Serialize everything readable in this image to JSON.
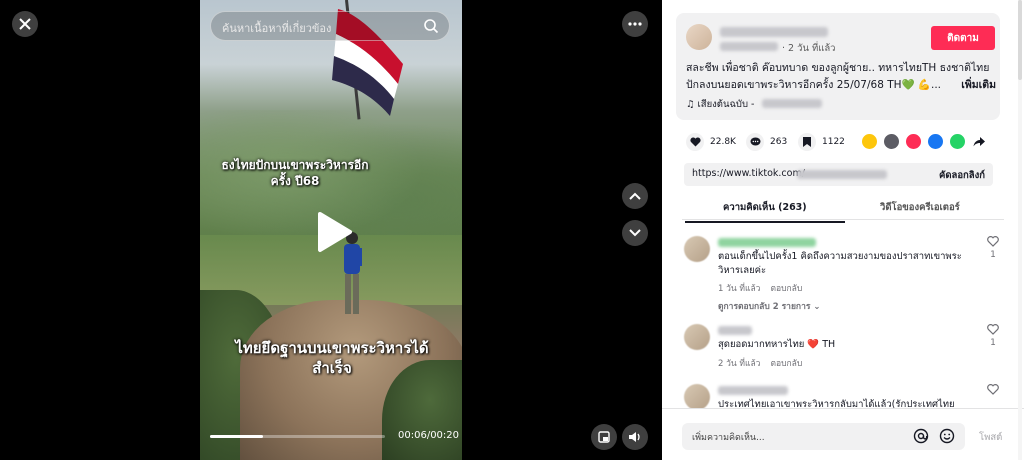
{
  "video": {
    "search_placeholder": "ค้นหาเนื้อหาที่เกี่ยวข้อง",
    "overlay_top": "ธงไทยปักบนเขาพระวิหารอีกครั้ง ปี68",
    "overlay_bottom": "ไทยยึดฐานบนเขาพระวิหารได้สำเร็จ",
    "time": "00:06/00:20",
    "progress_fraction": 0.3
  },
  "post": {
    "meta": "· 2 วัน ที่แล้ว",
    "follow_label": "ติดตาม",
    "caption": "สละชีพ เพื่อชาติ ค๊อบทบาด ของลูกผู้ชาย.. ทหารไทยTH ธงชาติไทยปักลงบนยอดเขาพระวิหารอีกครั้ง 25/07/68 TH💚 💪...",
    "more_label": "เพิ่มเติม",
    "music": "♫  เสียงต้นฉบับ -"
  },
  "actions": {
    "likes": "22.8K",
    "comments": "263",
    "saves": "1122"
  },
  "link": {
    "url": "https://www.tiktok.com/",
    "copy_label": "คัดลอกลิงก์"
  },
  "tabs": {
    "comments": "ความคิดเห็น (263)",
    "creator_videos": "วิดีโอของครีเอเตอร์"
  },
  "comments": [
    {
      "text": "ตอนเด็กขึ้นไปครั้ง1 คิดถึงความสวยงามของปราสาทเขาพระวิหารเลยค่ะ",
      "time": "1 วัน ที่แล้ว",
      "reply": "ตอบกลับ",
      "replies": "ดูการตอบกลับ 2 รายการ ⌄",
      "likes": "1"
    },
    {
      "text": "สุดยอดมากทหารไทย ❤️ TH",
      "time": "2 วัน ที่แล้ว",
      "reply": "ตอบกลับ",
      "likes": "1"
    },
    {
      "text": "ประเทศไทยเอาเขาพระวิหารกลับมาได้แล้ว(รักประเทศไทย"
    }
  ],
  "input": {
    "placeholder": "เพิ่มความคิดเห็น...",
    "post_label": "โพสต์"
  },
  "colors": {
    "accent": "#fe2c55",
    "panel_bg": "#ffffff",
    "card_bg": "#f1f1f2"
  }
}
